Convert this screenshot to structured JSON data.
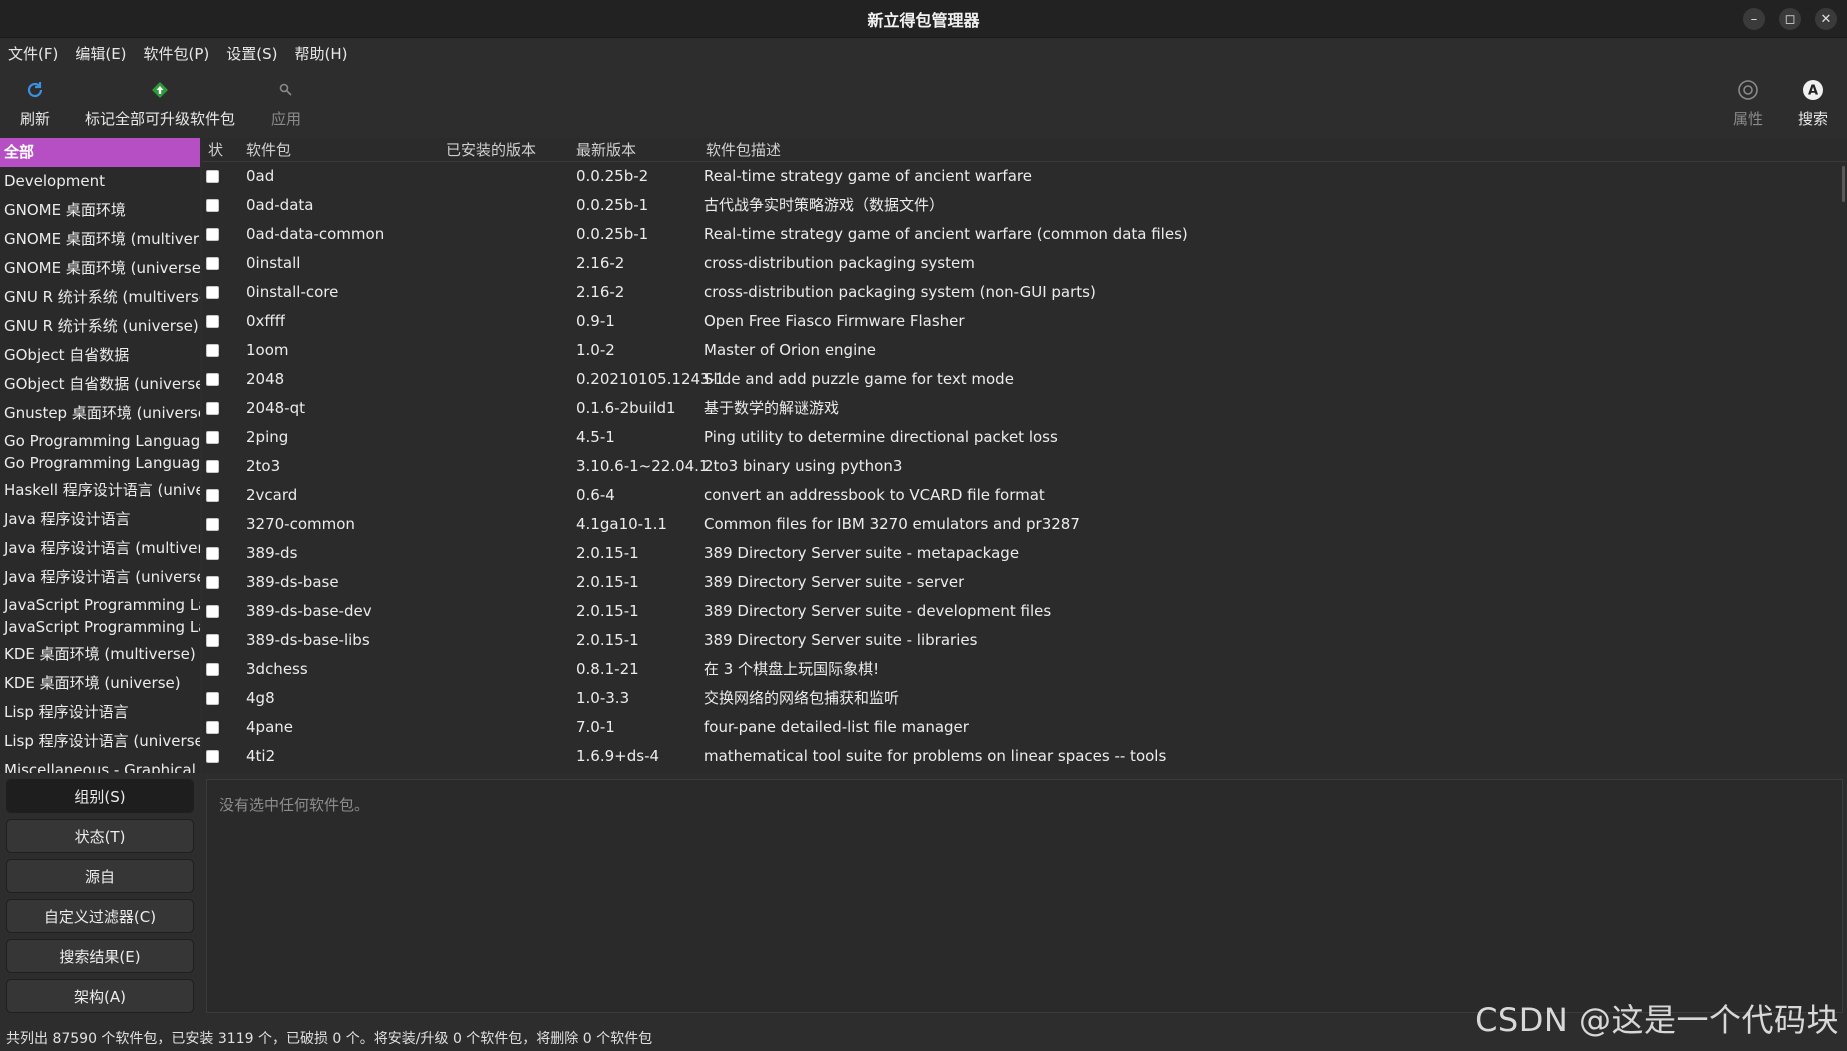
{
  "window": {
    "title": "新立得包管理器",
    "controls": {
      "minimize": "–",
      "maximize": "◻",
      "close": "✕"
    }
  },
  "menubar": [
    "文件(F)",
    "编辑(E)",
    "软件包(P)",
    "设置(S)",
    "帮助(H)"
  ],
  "toolbar": {
    "refresh": "刷新",
    "mark_all_upgrades": "标记全部可升级软件包",
    "apply": "应用",
    "properties": "属性",
    "search": "搜索"
  },
  "sidebar": {
    "items": [
      {
        "label": "全部",
        "selected": true
      },
      {
        "label": "Development"
      },
      {
        "label": "GNOME 桌面环境"
      },
      {
        "label": "GNOME 桌面环境 (multiverse)"
      },
      {
        "label": "GNOME 桌面环境 (universe)"
      },
      {
        "label": "GNU R 统计系统 (multiverse)"
      },
      {
        "label": "GNU R 统计系统 (universe)"
      },
      {
        "label": "GObject 自省数据"
      },
      {
        "label": "GObject 自省数据 (universe)"
      },
      {
        "label": "Gnustep 桌面环境 (universe)"
      },
      {
        "label": "Go Programming Language",
        "label2": "Go Programming Language (u"
      },
      {
        "label": "Haskell 程序设计语言 (univers"
      },
      {
        "label": "Java 程序设计语言"
      },
      {
        "label": "Java 程序设计语言 (multiverse"
      },
      {
        "label": "Java 程序设计语言 (universe)"
      },
      {
        "label": "JavaScript Programming Lang",
        "label2": "JavaScript Programming Lang"
      },
      {
        "label": "KDE 桌面环境 (multiverse)"
      },
      {
        "label": "KDE 桌面环境 (universe)"
      },
      {
        "label": "Lisp 程序设计语言"
      },
      {
        "label": "Lisp 程序设计语言 (universe)"
      },
      {
        "label": "Miscellaneous - Graphical"
      }
    ]
  },
  "table": {
    "headers": {
      "status": "状",
      "package": "软件包",
      "installed": "已安装的版本",
      "latest": "最新版本",
      "description": "软件包描述"
    },
    "rows": [
      {
        "package": "0ad",
        "installed": "",
        "latest": "0.0.25b-2",
        "description": "Real-time strategy game of ancient warfare"
      },
      {
        "package": "0ad-data",
        "installed": "",
        "latest": "0.0.25b-1",
        "description": "古代战争实时策略游戏（数据文件）"
      },
      {
        "package": "0ad-data-common",
        "installed": "",
        "latest": "0.0.25b-1",
        "description": "Real-time strategy game of ancient warfare (common data files)"
      },
      {
        "package": "0install",
        "installed": "",
        "latest": "2.16-2",
        "description": "cross-distribution packaging system"
      },
      {
        "package": "0install-core",
        "installed": "",
        "latest": "2.16-2",
        "description": "cross-distribution packaging system (non-GUI parts)"
      },
      {
        "package": "0xffff",
        "installed": "",
        "latest": "0.9-1",
        "description": "Open Free Fiasco Firmware Flasher"
      },
      {
        "package": "1oom",
        "installed": "",
        "latest": "1.0-2",
        "description": "Master of Orion engine"
      },
      {
        "package": "2048",
        "installed": "",
        "latest": "0.20210105.1243-1",
        "description": "Slide and add puzzle game for text mode"
      },
      {
        "package": "2048-qt",
        "installed": "",
        "latest": "0.1.6-2build1",
        "description": "基于数学的解谜游戏"
      },
      {
        "package": "2ping",
        "installed": "",
        "latest": "4.5-1",
        "description": "Ping utility to determine directional packet loss"
      },
      {
        "package": "2to3",
        "installed": "",
        "latest": "3.10.6-1~22.04.1",
        "description": "2to3 binary using python3"
      },
      {
        "package": "2vcard",
        "installed": "",
        "latest": "0.6-4",
        "description": "convert an addressbook to VCARD file format"
      },
      {
        "package": "3270-common",
        "installed": "",
        "latest": "4.1ga10-1.1",
        "description": "Common files for IBM 3270 emulators and pr3287"
      },
      {
        "package": "389-ds",
        "installed": "",
        "latest": "2.0.15-1",
        "description": "389 Directory Server suite - metapackage"
      },
      {
        "package": "389-ds-base",
        "installed": "",
        "latest": "2.0.15-1",
        "description": "389 Directory Server suite - server"
      },
      {
        "package": "389-ds-base-dev",
        "installed": "",
        "latest": "2.0.15-1",
        "description": "389 Directory Server suite - development files"
      },
      {
        "package": "389-ds-base-libs",
        "installed": "",
        "latest": "2.0.15-1",
        "description": "389 Directory Server suite - libraries"
      },
      {
        "package": "3dchess",
        "installed": "",
        "latest": "0.8.1-21",
        "description": "在 3 个棋盘上玩国际象棋!"
      },
      {
        "package": "4g8",
        "installed": "",
        "latest": "1.0-3.3",
        "description": "交换网络的网络包捕获和监听"
      },
      {
        "package": "4pane",
        "installed": "",
        "latest": "7.0-1",
        "description": "four-pane detailed-list file manager"
      },
      {
        "package": "4ti2",
        "installed": "",
        "latest": "1.6.9+ds-4",
        "description": "mathematical tool suite for problems on linear spaces -- tools"
      }
    ]
  },
  "filters": [
    "组别(S)",
    "状态(T)",
    "源自",
    "自定义过滤器(C)",
    "搜索结果(E)",
    "架构(A)"
  ],
  "details": {
    "message": "没有选中任何软件包。"
  },
  "statusbar": {
    "text": "共列出 87590 个软件包，已安装 3119 个，已破损 0 个。将安装/升级 0 个软件包，将删除 0 个软件包"
  },
  "watermark": "CSDN @这是一个代码块",
  "colors": {
    "accent": "#b64fc4",
    "background": "#2d2d2d"
  }
}
